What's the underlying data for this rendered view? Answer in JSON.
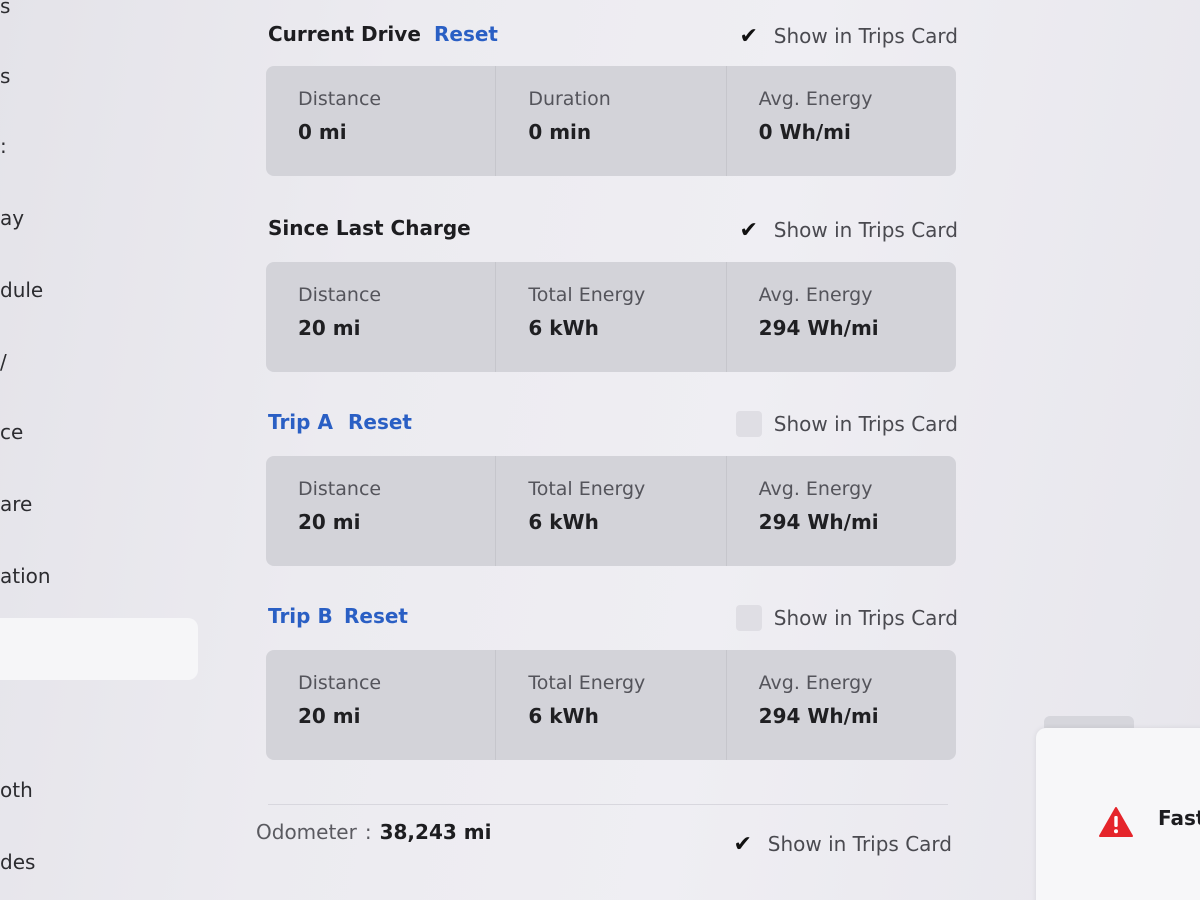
{
  "sidebar": {
    "items": [
      {
        "label": "s"
      },
      {
        "label": "s"
      },
      {
        "label": ":"
      },
      {
        "label": "ay"
      },
      {
        "label": "dule"
      },
      {
        "label": "/"
      },
      {
        "label": "ce"
      },
      {
        "label": "are"
      },
      {
        "label": "ation"
      },
      {
        "label": "oth"
      },
      {
        "label": "des"
      }
    ]
  },
  "show_label": "Show in Trips Card",
  "current_drive": {
    "title": "Current Drive",
    "reset": "Reset",
    "show_checked": true,
    "stats": [
      {
        "label": "Distance",
        "value": "0 mi"
      },
      {
        "label": "Duration",
        "value": "0 min"
      },
      {
        "label": "Avg. Energy",
        "value": "0 Wh/mi"
      }
    ]
  },
  "since_last_charge": {
    "title": "Since Last Charge",
    "show_checked": true,
    "stats": [
      {
        "label": "Distance",
        "value": "20 mi"
      },
      {
        "label": "Total Energy",
        "value": "6 kWh"
      },
      {
        "label": "Avg. Energy",
        "value": "294 Wh/mi"
      }
    ]
  },
  "trip_a": {
    "title": "Trip A",
    "reset": "Reset",
    "show_checked": false,
    "stats": [
      {
        "label": "Distance",
        "value": "20 mi"
      },
      {
        "label": "Total Energy",
        "value": "6 kWh"
      },
      {
        "label": "Avg. Energy",
        "value": "294 Wh/mi"
      }
    ]
  },
  "trip_b": {
    "title": "Trip B",
    "reset": "Reset",
    "show_checked": false,
    "stats": [
      {
        "label": "Distance",
        "value": "20 mi"
      },
      {
        "label": "Total Energy",
        "value": "6 kWh"
      },
      {
        "label": "Avg. Energy",
        "value": "294 Wh/mi"
      }
    ]
  },
  "odometer": {
    "label": "Odometer",
    "separator": ":",
    "value": "38,243 mi",
    "show_checked": true
  },
  "popup": {
    "icon": "warning-triangle-icon",
    "text": "Fast"
  },
  "colors": {
    "link_blue": "#2a5fc4",
    "warning_red": "#e5252b",
    "card_gray": "#d3d3d9"
  }
}
